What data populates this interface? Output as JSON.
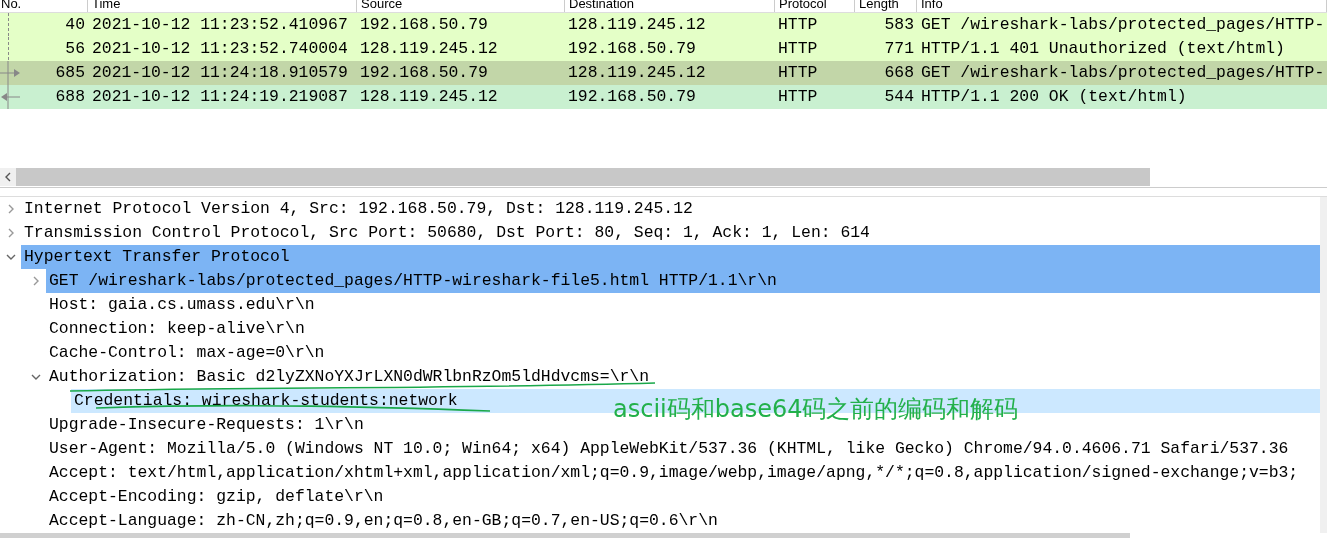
{
  "packet_list": {
    "columns": [
      "No.",
      "Time",
      "Source",
      "Destination",
      "Protocol",
      "Length",
      "Info"
    ],
    "rows": [
      {
        "no": "40",
        "time": "2021-10-12 11:23:52.410967",
        "source": "192.168.50.79",
        "destination": "128.119.245.12",
        "protocol": "HTTP",
        "length": "583",
        "info": "GET /wireshark-labs/protected_pages/HTTP-",
        "color": "#e4ffc7",
        "kind": "other"
      },
      {
        "no": "56",
        "time": "2021-10-12 11:23:52.740004",
        "source": "128.119.245.12",
        "destination": "192.168.50.79",
        "protocol": "HTTP",
        "length": "771",
        "info": "HTTP/1.1 401 Unauthorized  (text/html)",
        "color": "#e4ffc7",
        "kind": "other"
      },
      {
        "no": "685",
        "time": "2021-10-12 11:24:18.910579",
        "source": "192.168.50.79",
        "destination": "128.119.245.12",
        "protocol": "HTTP",
        "length": "668",
        "info": "GET /wireshark-labs/protected_pages/HTTP-",
        "color": "#c2d6a8",
        "kind": "request"
      },
      {
        "no": "688",
        "time": "2021-10-12 11:24:19.219087",
        "source": "128.119.245.12",
        "destination": "192.168.50.79",
        "protocol": "HTTP",
        "length": "544",
        "info": "HTTP/1.1 200 OK  (text/html)",
        "color": "#c9f0d0",
        "kind": "response"
      }
    ]
  },
  "packet_details": [
    {
      "text": "Internet Protocol Version 4, Src: 192.168.50.79, Dst: 128.119.245.12",
      "expanded": false,
      "selected": false,
      "highlighted": false
    },
    {
      "text": "Transmission Control Protocol, Src Port: 50680, Dst Port: 80, Seq: 1, Ack: 1, Len: 614",
      "expanded": false,
      "selected": false,
      "highlighted": false
    },
    {
      "text": "Hypertext Transfer Protocol",
      "expanded": true,
      "selected": true,
      "highlighted": false,
      "children": [
        {
          "text": "GET /wireshark-labs/protected_pages/HTTP-wireshark-file5.html HTTP/1.1\\r\\n",
          "expanded": false,
          "selected": true,
          "highlighted": false
        },
        {
          "text": "Host: gaia.cs.umass.edu\\r\\n",
          "selected": false,
          "highlighted": false
        },
        {
          "text": "Connection: keep-alive\\r\\n",
          "selected": false,
          "highlighted": false
        },
        {
          "text": "Cache-Control: max-age=0\\r\\n",
          "selected": false,
          "highlighted": false
        },
        {
          "text": "Authorization: Basic d2lyZXNoYXJrLXN0dWRlbnRzOm5ldHdvcms=\\r\\n",
          "expanded": true,
          "selected": false,
          "highlighted": false,
          "children": [
            {
              "text": "Credentials: wireshark-students:network",
              "selected": false,
              "highlighted": true
            }
          ]
        },
        {
          "text": "Upgrade-Insecure-Requests: 1\\r\\n",
          "selected": false,
          "highlighted": false
        },
        {
          "text": "User-Agent: Mozilla/5.0 (Windows NT 10.0; Win64; x64) AppleWebKit/537.36 (KHTML, like Gecko) Chrome/94.0.4606.71 Safari/537.36",
          "selected": false,
          "highlighted": false
        },
        {
          "text": "Accept: text/html,application/xhtml+xml,application/xml;q=0.9,image/webp,image/apng,*/*;q=0.8,application/signed-exchange;v=b3;",
          "selected": false,
          "highlighted": false
        },
        {
          "text": "Accept-Encoding: gzip, deflate\\r\\n",
          "selected": false,
          "highlighted": false
        },
        {
          "text": "Accept-Language: zh-CN,zh;q=0.9,en;q=0.8,en-GB;q=0.7,en-US;q=0.6\\r\\n",
          "selected": false,
          "highlighted": false
        }
      ]
    }
  ],
  "annotation": "ascii码和base64码之前的编码和解码"
}
